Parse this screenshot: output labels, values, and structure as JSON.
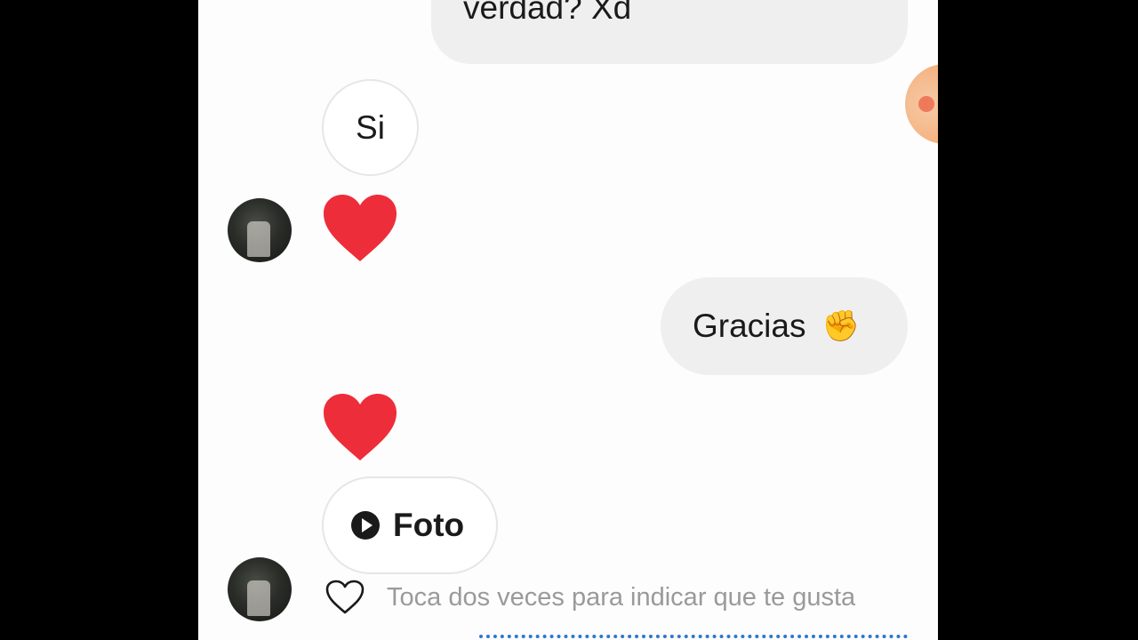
{
  "messages": {
    "outgoing_1": "verdad? Xd",
    "incoming_1": "Si",
    "outgoing_2": "Gracias",
    "outgoing_2_emoji": "✊",
    "incoming_photo": "Foto"
  },
  "like_hint": "Toca dos veces para indicar que te gusta",
  "colors": {
    "heart": "#ee2d3a",
    "outgoing_bubble": "#efefef",
    "incoming_border": "#e6e6e6",
    "link_dots": "#2f77c9"
  },
  "icons": [
    "heart-reaction-icon",
    "play-icon",
    "like-heart-outline-icon",
    "contact-avatar"
  ]
}
